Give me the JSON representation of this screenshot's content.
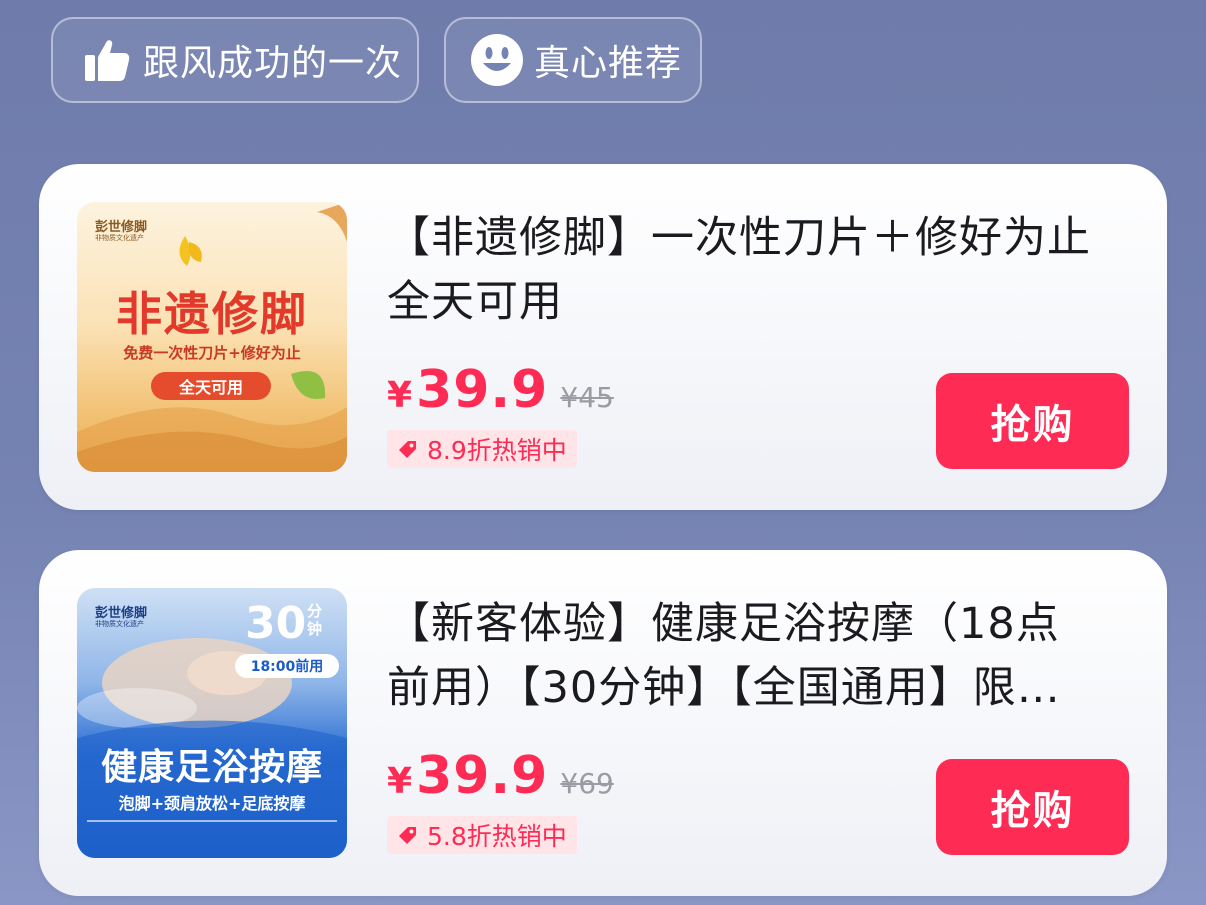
{
  "tags": [
    {
      "label": "跟风成功的一次",
      "icon": "thumbs-up-icon"
    },
    {
      "label": "真心推荐",
      "icon": "smile-face-icon"
    }
  ],
  "products": [
    {
      "title": "【非遗修脚】一次性刀片＋修好为止 全天可用",
      "currency": "¥",
      "price": "39.9",
      "original_price": "¥45",
      "discount": "8.9折热销中",
      "buy_label": "抢购",
      "thumb": {
        "brand": "彭世修脚",
        "brand_sub": "非物质文化遗产",
        "headline": "非遗修脚",
        "subline": "免费一次性刀片+修好为止",
        "badge": "全天可用"
      }
    },
    {
      "title": "【新客体验】健康足浴按摩（18点前用）【30分钟】【全国通用】限…",
      "currency": "¥",
      "price": "39.9",
      "original_price": "¥69",
      "discount": "5.8折热销中",
      "buy_label": "抢购",
      "thumb": {
        "brand": "彭世修脚",
        "brand_sub": "非物质文化遗产",
        "minutes": "30",
        "minutes_unit": "分钟",
        "time_badge": "18:00前用",
        "headline": "健康足浴按摩",
        "subline": "泡脚+颈肩放松+足底按摩"
      }
    }
  ],
  "colors": {
    "accent": "#fe2c55",
    "background": "#7583b3",
    "discount_bg": "#ffe4e8"
  }
}
